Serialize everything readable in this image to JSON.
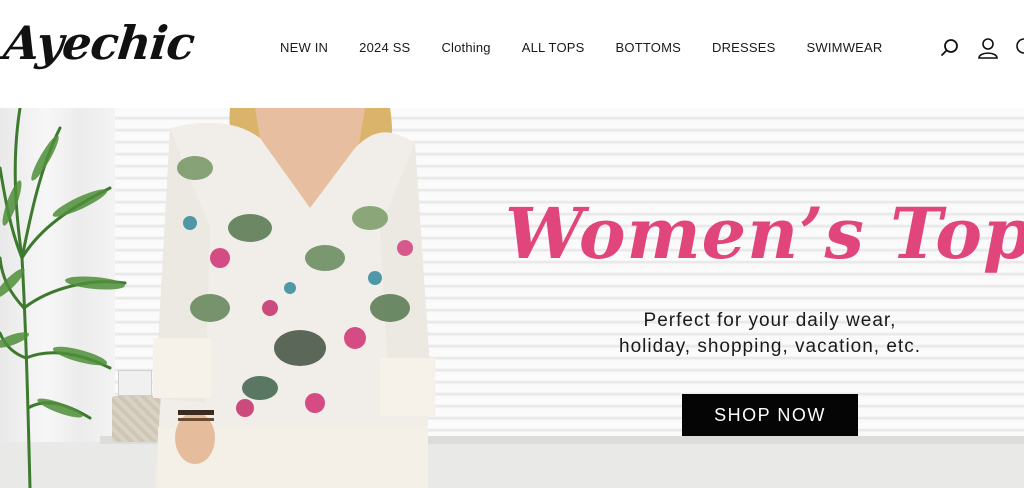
{
  "brand": {
    "logo_text": "Ayechic"
  },
  "nav": {
    "items": [
      {
        "label": "NEW IN"
      },
      {
        "label": "2024 SS"
      },
      {
        "label": "Clothing"
      },
      {
        "label": "ALL TOPS"
      },
      {
        "label": "BOTTOMS"
      },
      {
        "label": "DRESSES"
      },
      {
        "label": "SWIMWEAR"
      }
    ]
  },
  "header_icons": [
    {
      "icon": "search-icon"
    },
    {
      "icon": "user-icon"
    },
    {
      "icon": "cart-icon"
    }
  ],
  "hero": {
    "title": "Women’s Tops",
    "subtitle_line1": "Perfect for your daily wear,",
    "subtitle_line2": "holiday, shopping, vacation, etc.",
    "cta_label": "SHOP NOW"
  },
  "colors": {
    "accent_pink": "#e0457b",
    "button_bg": "#050505",
    "button_text": "#ffffff",
    "text": "#1a1a1a"
  }
}
